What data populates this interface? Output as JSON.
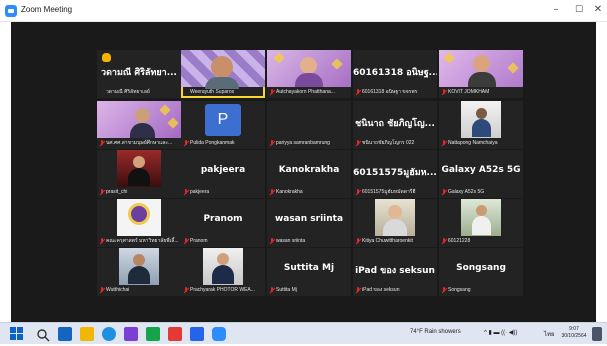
{
  "window": {
    "title": "Zoom Meeting",
    "minimize": "–",
    "maximize": "☐",
    "close": "✕"
  },
  "tiles": [
    {
      "big": "วดามณี ศิริลัทยา...",
      "caption": "วดามณี ศิริลัทยาเลย์"
    },
    {
      "big": "",
      "caption": "Weerayuth Suparos"
    },
    {
      "big": "",
      "caption": "Autchayakorn Phatthana..."
    },
    {
      "big": "60161318 อนิษฐ...",
      "caption": "60161318 อนิษฐา ขจรพร"
    },
    {
      "big": "",
      "caption": "KOVIT JOMKHAM"
    },
    {
      "big": "",
      "caption": "นศ.ศศ.สาขามนุษย์ศึกษาและ..."
    },
    {
      "big": "",
      "caption": "Pulida Pongkanmak"
    },
    {
      "big": "",
      "caption": "pariyya samranbamrung"
    },
    {
      "big": "ชนินาถ ชัยภิญโญ...",
      "caption": "ชนินาถชัยภิญโญกร 022"
    },
    {
      "big": "",
      "caption": "Nattapong Namchaiya"
    },
    {
      "big": "",
      "caption": "prasit_chi"
    },
    {
      "big": "pakjeera",
      "caption": "pakjeera"
    },
    {
      "big": "Kanokrakha",
      "caption": "Kanokrakha"
    },
    {
      "big": "60151575มูฮัมห...",
      "caption": "60151575มูฮัมหมัดดารีฮี"
    },
    {
      "big": "Galaxy A52s 5G",
      "caption": "Galaxy A52s 5G"
    },
    {
      "big": "",
      "caption": "คณะครุศาสตร์ มหาวิทยาลัยพี่เลี้..."
    },
    {
      "big": "Pranom",
      "caption": "Pranom"
    },
    {
      "big": "wasan sriinta",
      "caption": "wasan sriinta"
    },
    {
      "big": "",
      "caption": "Kitiya Chuwittharoenkit"
    },
    {
      "big": "",
      "caption": "60121228"
    },
    {
      "big": "",
      "caption": "Wutthichai"
    },
    {
      "big": "",
      "caption": "Prachyarak PHOTOR WEA..."
    },
    {
      "big": "Suttita Mj",
      "caption": "Suttita Mj"
    },
    {
      "big": "iPad ของ seksun",
      "caption": "iPad ของ seksun"
    },
    {
      "big": "Songsang",
      "caption": "Songsang"
    }
  ],
  "avatar_letter": "P",
  "taskbar": {
    "weather": "74°F  Rain showers",
    "lang": "ไทย",
    "time": "9:07",
    "date": "30/10/2564"
  },
  "colors": {
    "meeting_bg": "#1a1a1a",
    "tile_bg": "#232323",
    "active_speaker": "#f7d532",
    "muted_mic": "#e02828",
    "zoom_blue": "#2d8cff"
  }
}
